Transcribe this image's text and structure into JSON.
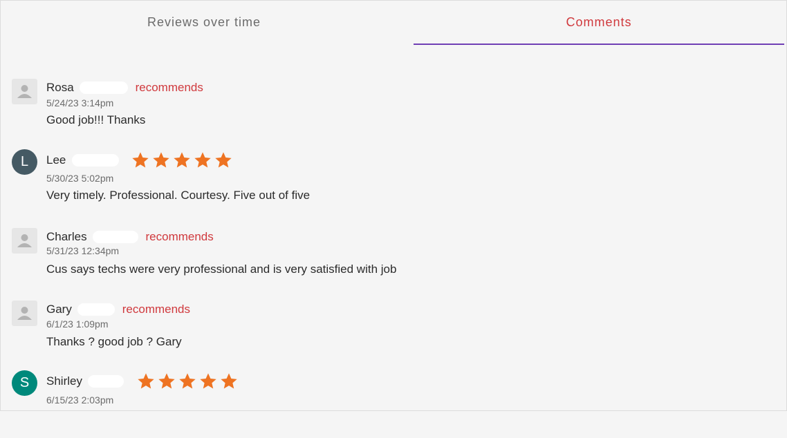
{
  "tabs": {
    "reviews_over_time": "Reviews over time",
    "comments": "Comments"
  },
  "colors": {
    "accent_red": "#d0393d",
    "tab_underline": "#6f3fb4",
    "star": "#ee7322",
    "avatar_lee": "#455a64",
    "avatar_shirley": "#00897b"
  },
  "comments": [
    {
      "name": "Rosa",
      "avatar": "person-icon",
      "type": "recommends",
      "recommends_label": "recommends",
      "date": "5/24/23 3:14pm",
      "text": "Good job!!! Thanks"
    },
    {
      "name": "Lee",
      "avatar_letter": "L",
      "type": "stars",
      "rating": 5,
      "date": "5/30/23 5:02pm",
      "text": "Very timely. Professional. Courtesy. Five out of five"
    },
    {
      "name": "Charles",
      "avatar": "person-icon",
      "type": "recommends",
      "recommends_label": "recommends",
      "date": "5/31/23 12:34pm",
      "text": "Cus says techs were very professional and is very satisfied with job"
    },
    {
      "name": "Gary",
      "avatar": "person-icon",
      "type": "recommends",
      "recommends_label": "recommends",
      "date": "6/1/23 1:09pm",
      "text": "Thanks ? good job ? Gary"
    },
    {
      "name": "Shirley",
      "avatar_letter": "S",
      "type": "stars",
      "rating": 5,
      "date": "6/15/23 2:03pm",
      "text": ""
    }
  ]
}
